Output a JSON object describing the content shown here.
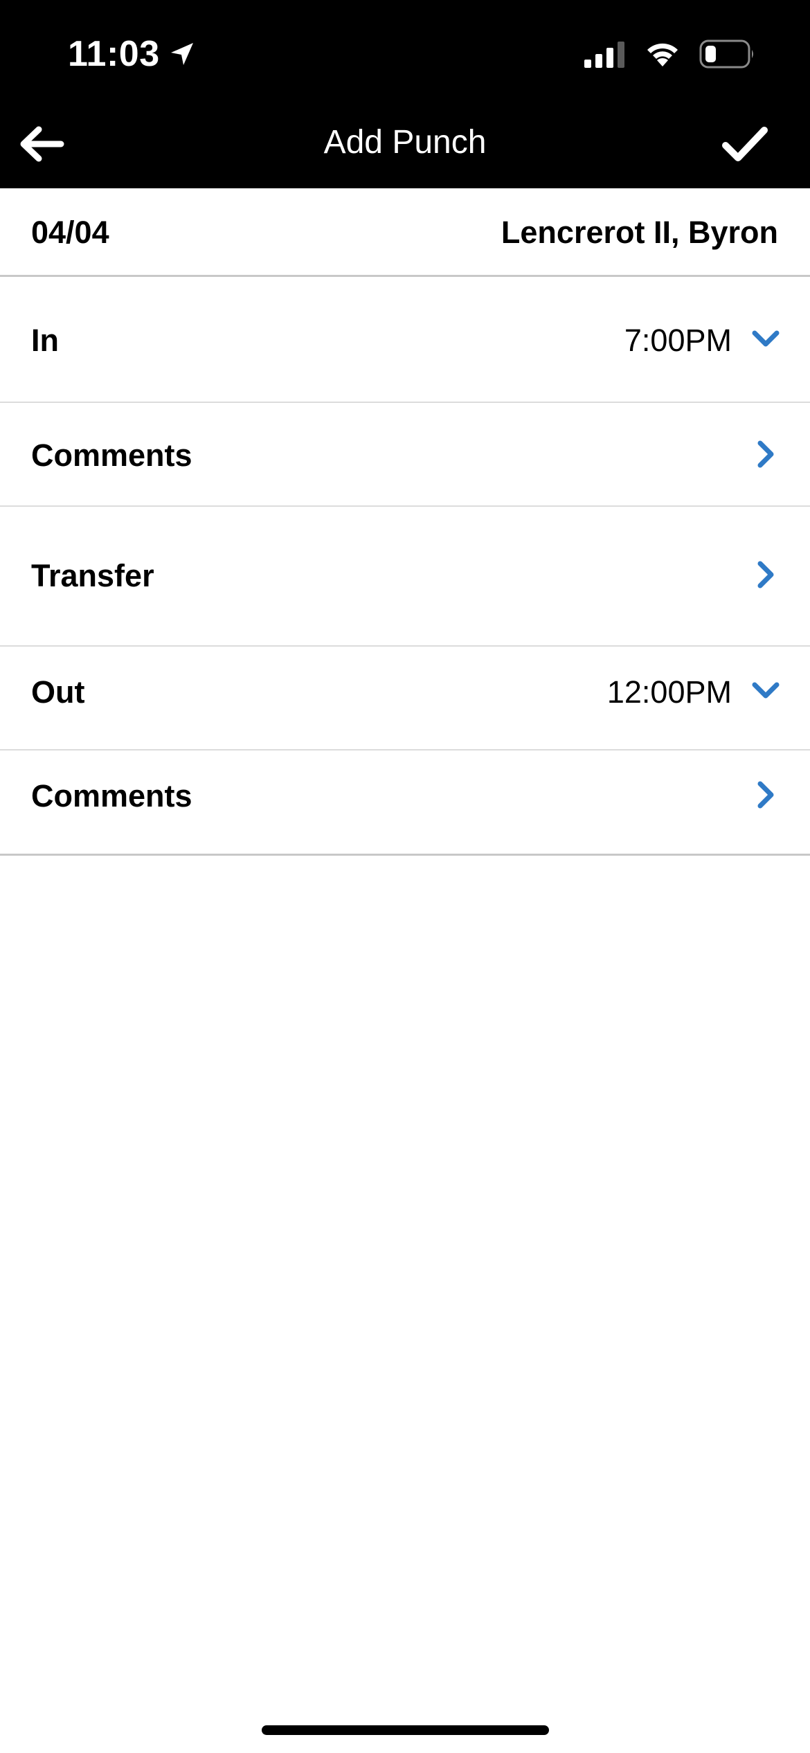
{
  "status_bar": {
    "time": "11:03",
    "battery_level": 0.2
  },
  "nav": {
    "title": "Add Punch"
  },
  "info": {
    "date": "04/04",
    "employee": "Lencrerot II, Byron"
  },
  "rows": [
    {
      "label": "In",
      "value": "7:00PM",
      "icon": "chevron-down-icon"
    },
    {
      "label": "Comments",
      "value": "",
      "icon": "chevron-right-icon"
    },
    {
      "label": "Transfer",
      "value": "",
      "icon": "chevron-right-icon"
    },
    {
      "label": "Out",
      "value": "12:00PM",
      "icon": "chevron-down-icon"
    },
    {
      "label": "Comments",
      "value": "",
      "icon": "chevron-right-icon"
    }
  ],
  "colors": {
    "header_bg": "#000000",
    "accent": "#2f7ac6",
    "divider": "#dcdcdc"
  }
}
